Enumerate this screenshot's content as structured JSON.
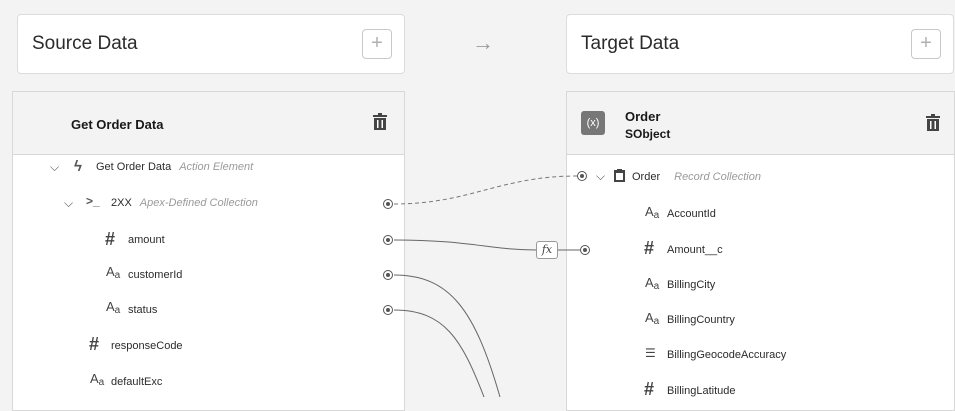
{
  "source": {
    "title": "Source Data"
  },
  "target": {
    "title": "Target Data"
  },
  "plus_glyph": "+",
  "arrow_glyph": "→",
  "source_card": {
    "title": "Get Order Data",
    "rows": {
      "root": {
        "label": "Get Order Data",
        "meta": "Action Element"
      },
      "collection": {
        "label": "2XX",
        "meta": "Apex-Defined Collection"
      },
      "amount": {
        "label": "amount"
      },
      "customerId": {
        "label": "customerId"
      },
      "status": {
        "label": "status"
      },
      "responseCode": {
        "label": "responseCode"
      },
      "defaultExc": {
        "label": "defaultExc"
      }
    }
  },
  "target_card": {
    "title": "Order",
    "subtitle": "SObject",
    "icon_glyph": "(x)",
    "rows": {
      "root": {
        "label": "Order",
        "meta": "Record Collection"
      },
      "accountId": {
        "label": "AccountId"
      },
      "amount": {
        "label": "Amount__c"
      },
      "billingCity": {
        "label": "BillingCity"
      },
      "billingCountry": {
        "label": "BillingCountry"
      },
      "billingGeocode": {
        "label": "BillingGeocodeAccuracy"
      },
      "billingLatitude": {
        "label": "BillingLatitude"
      }
    }
  },
  "fx_label": "fx",
  "icons": {
    "number": "#",
    "text_A": "A",
    "text_a": "a",
    "list": "☰",
    "chevron": "⌵",
    "bolt": "ϟ",
    "prompt": ">_"
  }
}
